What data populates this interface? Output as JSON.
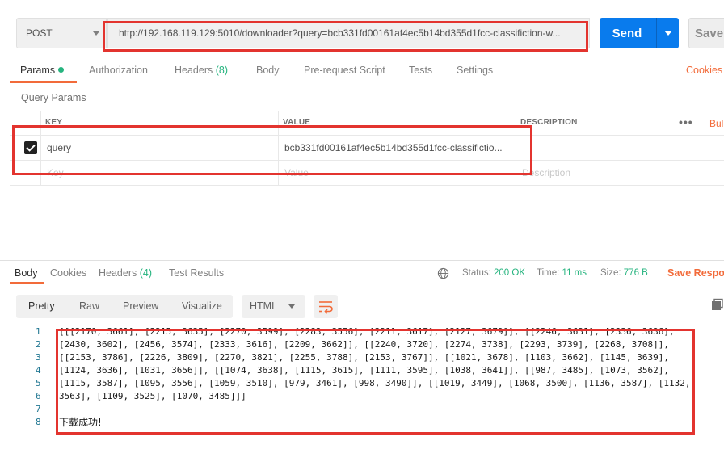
{
  "request": {
    "method": "POST",
    "url": "http://192.168.119.129:5010/downloader?query=bcb331fd00161af4ec5b14bd355d1fcc-classifiction-w...",
    "send_label": "Send",
    "save_label": "Save"
  },
  "request_tabs": {
    "params": "Params",
    "authorization": "Authorization",
    "headers": "Headers",
    "headers_count": "(8)",
    "body": "Body",
    "prerequest": "Pre-request Script",
    "tests": "Tests",
    "settings": "Settings",
    "cookies": "Cookies"
  },
  "params": {
    "title": "Query Params",
    "columns": {
      "key": "KEY",
      "value": "VALUE",
      "description": "DESCRIPTION"
    },
    "bulk_edit": "Bulk Edit",
    "rows": [
      {
        "checked": true,
        "key": "query",
        "value": "bcb331fd00161af4ec5b14bd355d1fcc-classifictio...",
        "description": ""
      }
    ],
    "placeholder": {
      "key": "Key",
      "value": "Value",
      "description": "Description"
    }
  },
  "response_tabs": {
    "body": "Body",
    "cookies": "Cookies",
    "headers": "Headers",
    "headers_count": "(4)",
    "test_results": "Test Results"
  },
  "status": {
    "status_label": "Status:",
    "status_value": "200 OK",
    "time_label": "Time:",
    "time_value": "11 ms",
    "size_label": "Size:",
    "size_value": "776 B",
    "save_response": "Save Response"
  },
  "view_modes": {
    "pretty": "Pretty",
    "raw": "Raw",
    "preview": "Preview",
    "visualize": "Visualize"
  },
  "format": "HTML",
  "code": {
    "line_numbers": [
      "1",
      "2",
      "3",
      "4",
      "5",
      "6",
      "7",
      "8"
    ],
    "lines": [
      "[[[2170, 3661], [2215, 3635], [2270, 3599], [2283, 3556], [2211, 3617], [2127, 3679]], [[2246, 3631], [2336, 3636],",
      "[2430, 3602], [2456, 3574], [2333, 3616], [2209, 3662]], [[2240, 3720], [2274, 3738], [2293, 3739], [2268, 3708]],",
      "[[2153, 3786], [2226, 3809], [2270, 3821], [2255, 3788], [2153, 3767]], [[1021, 3678], [1103, 3662], [1145, 3639],",
      "[1124, 3636], [1031, 3656]], [[1074, 3638], [1115, 3615], [1111, 3595], [1038, 3641]], [[987, 3485], [1073, 3562],",
      "[1115, 3587], [1095, 3556], [1059, 3510], [979, 3461], [998, 3490]], [[1019, 3449], [1068, 3500], [1136, 3587], [1132,",
      "3563], [1109, 3525], [1070, 3485]]]",
      "",
      "下载成功!"
    ]
  },
  "colors": {
    "accent_orange": "#f26b3a",
    "send_blue": "#097bed",
    "success_green": "#26b47f",
    "annotation_red": "#e3342f"
  }
}
